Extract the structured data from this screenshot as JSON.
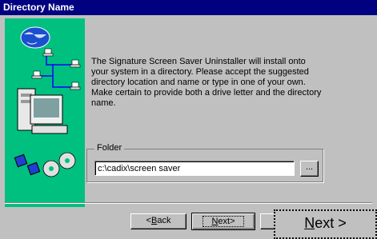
{
  "window": {
    "title": "Directory Name"
  },
  "description": "The Signature Screen Saver Uninstaller will install onto your system in a directory.  Please accept the suggested directory location and name or type in one of your own.  Make certain to provide both a drive letter and the directory name.",
  "folder": {
    "label": "Folder",
    "value": "c:\\cadix\\screen saver",
    "browse_label": "..."
  },
  "buttons": {
    "back_mnemonic": "B",
    "back_rest": "ack",
    "back_prefix": "<",
    "next_mnemonic": "N",
    "next_rest": "ext>",
    "cancel_label": ""
  },
  "zoom": {
    "mnemonic": "N",
    "rest": "ext >"
  },
  "colors": {
    "title_bg": "#000080",
    "art_bg": "#00c080",
    "face": "#c0c0c0"
  }
}
